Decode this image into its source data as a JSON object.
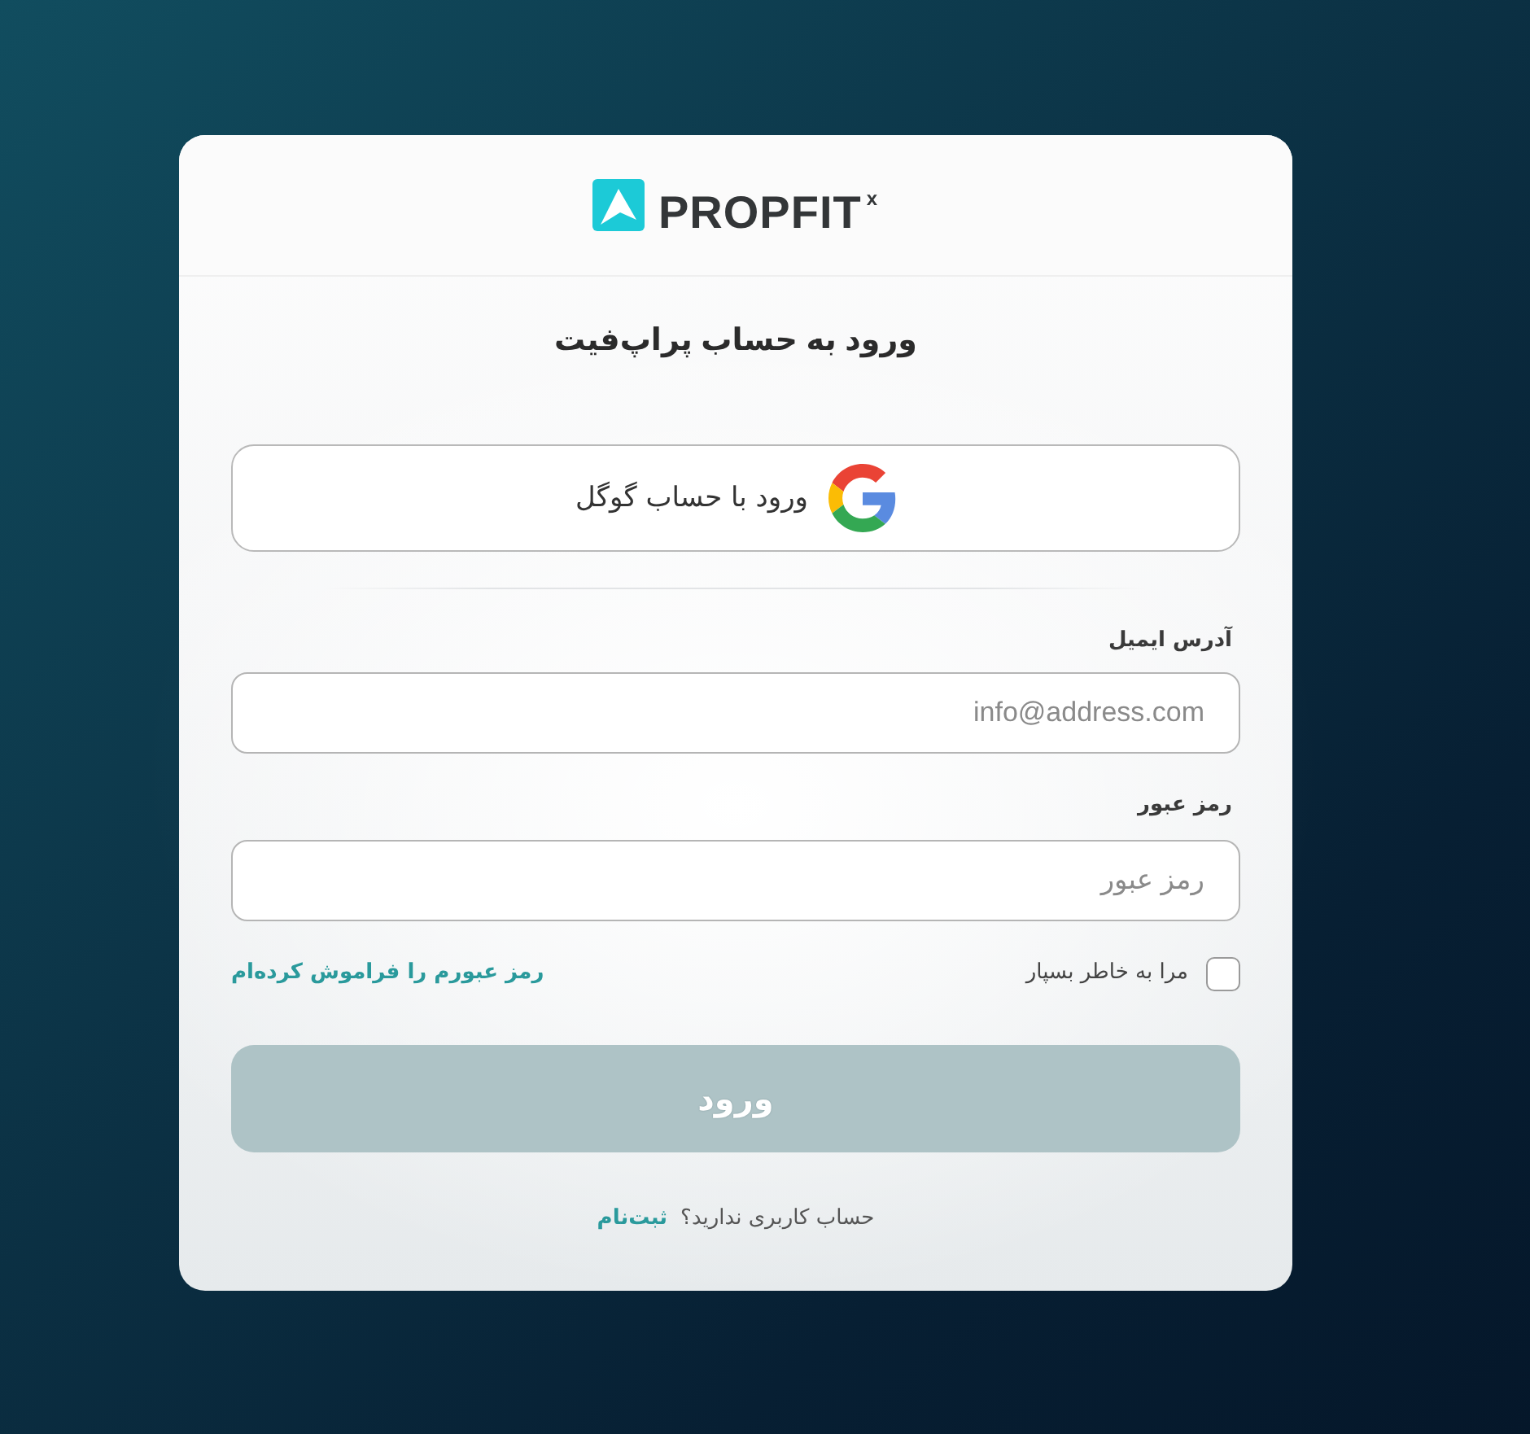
{
  "logo": {
    "wordmark": "PROPFIT$^{x}$"
  },
  "title": "ورود به حساب پراپ‌فیت",
  "google_button": {
    "label": "ورود با حساب گوگل"
  },
  "fields": [
    {
      "label": "آدرس ایمیل",
      "placeholder": "info@address.com"
    },
    {
      "label": "رمز عبور",
      "placeholder": "رمز عبور"
    }
  ],
  "remember_me": {
    "label": "مرا به خاطر بسپار",
    "checked": false
  },
  "forgot_password_link": "رمز عبورم را فراموش کرده‌ام",
  "submit_button": {
    "label": "ورود",
    "disabled": true
  },
  "signup": {
    "prompt": "حساب کاربری ندارید؟",
    "link": "ثبت‌نام"
  }
}
